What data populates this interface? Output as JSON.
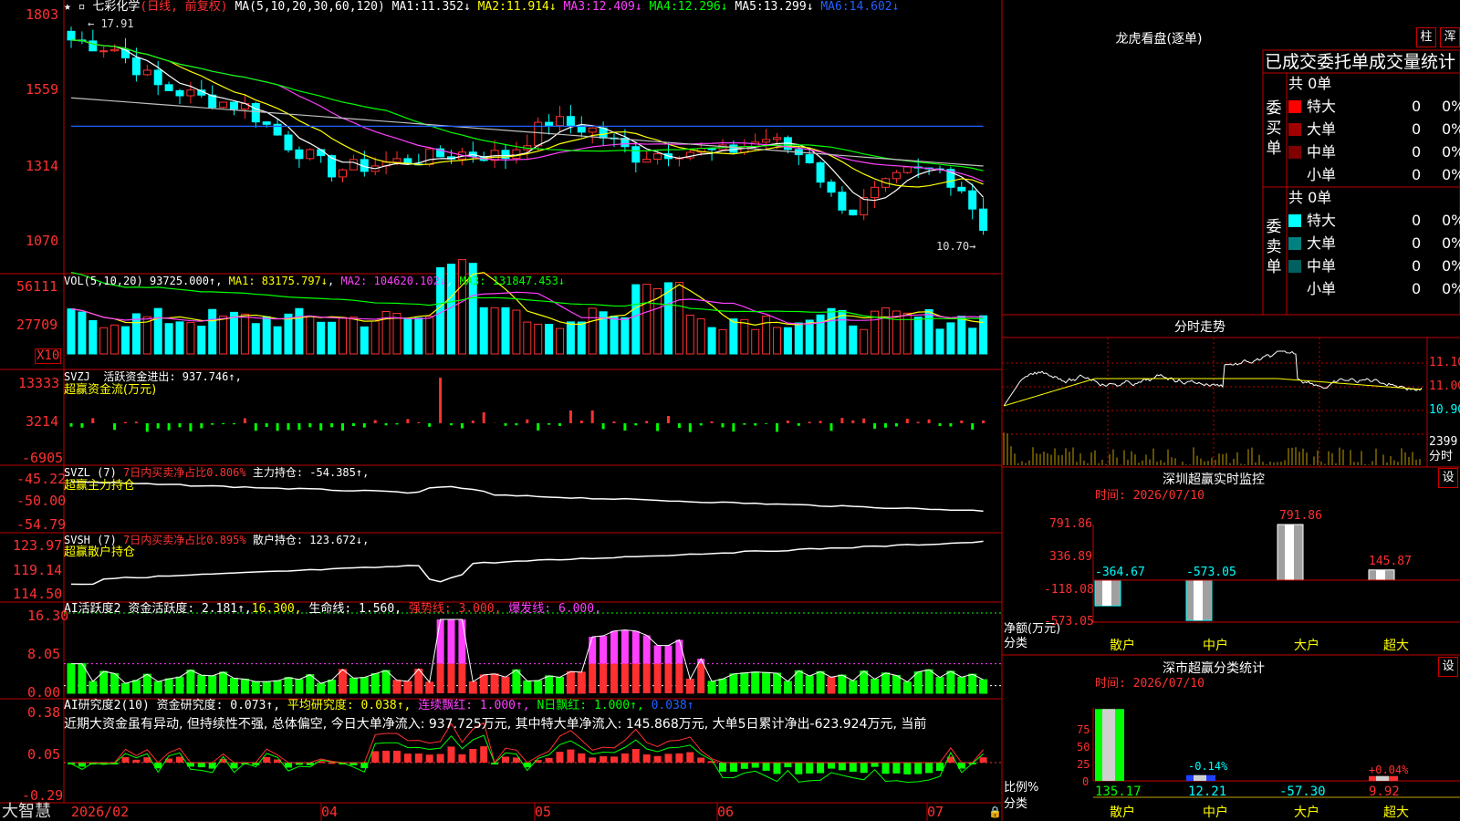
{
  "app": {
    "brand": "大智慧"
  },
  "stock": {
    "name": "七彩化学",
    "period": "(日线, 前复权)"
  },
  "colors": {
    "up": "#ff3030",
    "down": "#00ffff",
    "grid": "#c00000",
    "ma1": "#ffffff",
    "ma2": "#ffff00",
    "ma3": "#ff40ff",
    "ma4": "#00ff00",
    "ma5": "#c0c0c0",
    "ma6": "#2060ff"
  },
  "main": {
    "ma_label": "MA(5,10,20,30,60,120)",
    "ma": [
      {
        "name": "MA1:",
        "value": "11.352↓"
      },
      {
        "name": "MA2:",
        "value": "11.914↓"
      },
      {
        "name": "MA3:",
        "value": "12.409↓"
      },
      {
        "name": "MA4:",
        "value": "12.296↓"
      },
      {
        "name": "MA5:",
        "value": "13.299↓"
      },
      {
        "name": "MA6:",
        "value": "14.602↓"
      }
    ],
    "yticks": [
      "1803",
      "1559",
      "1314",
      "1070"
    ],
    "high_label": "17.91",
    "low_label": "10.70"
  },
  "vol": {
    "label": "VOL(5,10,20)",
    "value": "93725.000↑",
    "ma1": "MA1: 83175.797↓",
    "ma2": "MA2: 104620.102↓",
    "ma3": "MA3: 131847.453↓",
    "yticks": [
      "56111",
      "27709"
    ],
    "unit": "X10"
  },
  "svzj": {
    "label": "SVZJ",
    "desc": "活跃资金进出: 937.746↑,",
    "sub": "超赢资金流(万元)",
    "yticks": [
      "13333",
      "3214",
      "-6905"
    ]
  },
  "svzl": {
    "label": "SVZL (7)",
    "desc": "7日内买卖净占比0.806%",
    "desc2": "主力持仓: -54.385↑,",
    "sub": "超赢主力持仓",
    "yticks": [
      "-45.22",
      "-50.00",
      "-54.79"
    ]
  },
  "svsh": {
    "label": "SVSH (7)",
    "desc": "7日内买卖净占比0.895%",
    "desc2": "散户持仓: 123.672↓,",
    "sub": "超赢散户持仓",
    "yticks": [
      "123.97",
      "119.14",
      "114.50"
    ]
  },
  "ai1": {
    "label": "AI活跃度2",
    "d1": "资金活跃度: 2.181↑,",
    "d2": "16.300,",
    "d3": "生命线: 1.560,",
    "d4": "强势线: 3.000,",
    "d5": "爆发线: 6.000,",
    "yticks": [
      "16.30",
      "8.05",
      "0.00"
    ]
  },
  "ai2": {
    "label": "AI研究度2(10)",
    "d1": "资金研究度: 0.073↑,",
    "d2": "平均研究度: 0.038↑,",
    "d3": "连续飘红: 1.000↑,",
    "d4": "N日飘红: 1.000↑,",
    "d5": "0.038↑",
    "text": "近期大资金虽有异动, 但持续性不强, 总体偏空, 今日大单净流入: 937.725万元, 其中特大单净流入: 145.868万元, 大单5日累计净出-623.924万元, 当前",
    "yticks": [
      "0.38",
      "0.05",
      "-0.29"
    ]
  },
  "xaxis": [
    "2026/02",
    "04",
    "05",
    "06",
    "07"
  ],
  "dragon": {
    "title": "龙虎看盘(逐单)",
    "btn1": "柱",
    "btn2": "浑",
    "header": "已成交委托单成交量统计",
    "buy_label": "委买单",
    "sell_label": "委卖单",
    "buy_total": "共 0单",
    "sell_total": "共 0单",
    "buy_rows": [
      {
        "n": "特大",
        "v": "0",
        "p": "0%"
      },
      {
        "n": "大单",
        "v": "0",
        "p": "0%"
      },
      {
        "n": "中单",
        "v": "0",
        "p": "0%"
      },
      {
        "n": "小单",
        "v": "0",
        "p": "0%"
      }
    ],
    "sell_rows": [
      {
        "n": "特大",
        "v": "0",
        "p": "0%"
      },
      {
        "n": "大单",
        "v": "0",
        "p": "0%"
      },
      {
        "n": "中单",
        "v": "0",
        "p": "0%"
      },
      {
        "n": "小单",
        "v": "0",
        "p": "0%"
      }
    ],
    "buy_colors": [
      "#ff0000",
      "#a00000",
      "#800000",
      ""
    ],
    "sell_colors": [
      "#00ffff",
      "#008080",
      "#006060",
      ""
    ]
  },
  "intraday": {
    "title": "分时走势",
    "y": [
      "11.10",
      "11.00",
      "10.90"
    ],
    "vol": "2399",
    "vol_unit": "分时"
  },
  "sz_monitor": {
    "title": "深圳超赢实时监控",
    "btn": "设",
    "time": "时间: 2026/07/10",
    "yticks": [
      "791.86",
      "336.89",
      "-118.08",
      "-573.05"
    ],
    "ylabel1": "净额(万元)",
    "ylabel2": "分类",
    "cats": [
      "散户",
      "中户",
      "大户",
      "超大"
    ],
    "values": [
      -364.67,
      -573.05,
      791.86,
      145.87
    ],
    "labels": [
      "-364.67",
      "-573.05",
      "791.86",
      "145.87"
    ]
  },
  "sz_class": {
    "title": "深市超赢分类统计",
    "btn": "设",
    "time": "时间: 2026/07/10",
    "yticks": [
      "75",
      "50",
      "25",
      "0"
    ],
    "ylabel1": "比例%",
    "ylabel2": "分类",
    "cats": [
      "散户",
      "中户",
      "大户",
      "超大"
    ],
    "bar_labels": [
      "-0.14%",
      "+0.04%"
    ],
    "bottom": [
      "135.17",
      "12.21",
      "-57.30",
      "9.92"
    ],
    "bars": [
      75,
      6,
      0,
      5
    ]
  }
}
